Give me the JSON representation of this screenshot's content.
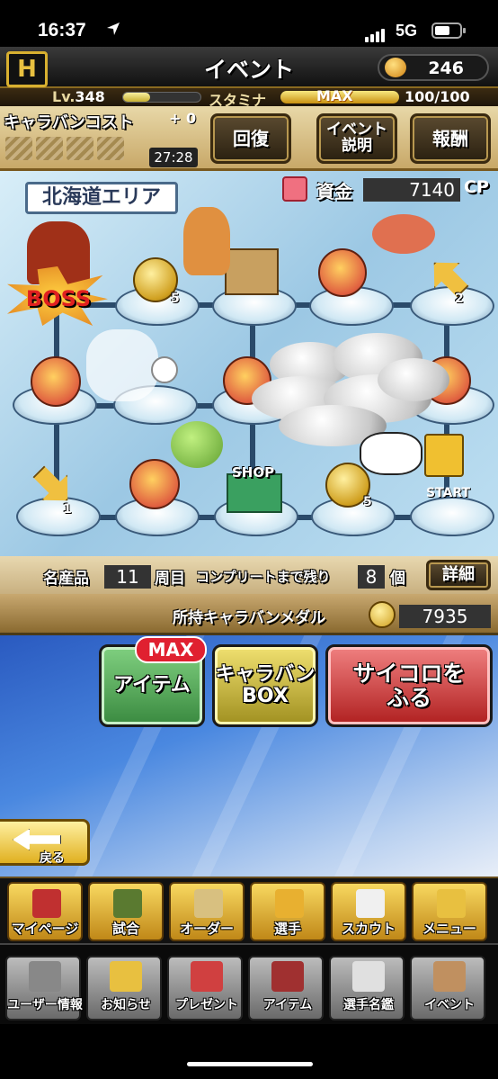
{
  "status_bar": {
    "time": "16:37",
    "network": "5G"
  },
  "header": {
    "title": "イベント",
    "logo": "H",
    "coins": "246"
  },
  "level": {
    "label": "Lv.",
    "value": "348",
    "exp_fraction": 0.35,
    "stamina_label": "スタミナ",
    "stamina_badge": "MAX",
    "stamina_value": "100/100"
  },
  "caravan": {
    "cost_title": "キャラバンコスト",
    "cost_plus": "+ 0",
    "timer": "27:28"
  },
  "commands": {
    "recover": "回復",
    "event_desc_1": "イベント",
    "event_desc_2": "説明",
    "reward": "報酬"
  },
  "map": {
    "area": "北海道エリア",
    "fund_label": "資金",
    "fund_value": "7140",
    "fund_unit": "CP",
    "boss_label": "BOSS",
    "shop_label": "SHOP",
    "start_label": "START",
    "tile_numbers": [
      "5",
      "2",
      "1",
      "5"
    ]
  },
  "progress": {
    "label_products": "名産品",
    "laps": "11",
    "laps_unit": "周目",
    "remain_label": "コンプリートまで残り",
    "remain": "8",
    "remain_unit": "個",
    "detail": "詳細"
  },
  "medals": {
    "label": "所持キャラバンメダル",
    "value": "7935"
  },
  "actions": {
    "max_badge": "MAX",
    "item": "アイテム",
    "box_1": "キャラバン",
    "box_2": "BOX",
    "dice_1": "サイコロを",
    "dice_2": "ふる"
  },
  "back": "戻る",
  "nav_main": [
    {
      "label": "マイページ",
      "color": "#c03030"
    },
    {
      "label": "試合",
      "color": "#5a7a30"
    },
    {
      "label": "オーダー",
      "color": "#d8c080"
    },
    {
      "label": "選手",
      "color": "#e8b030"
    },
    {
      "label": "スカウト",
      "color": "#f0f0f0"
    },
    {
      "label": "メニュー",
      "color": "#e8c040"
    }
  ],
  "nav_sub": [
    {
      "label": "ユーザー情報",
      "color": "#888"
    },
    {
      "label": "お知らせ",
      "color": "#e8c040"
    },
    {
      "label": "プレゼント",
      "color": "#d04040"
    },
    {
      "label": "アイテム",
      "color": "#a03030"
    },
    {
      "label": "選手名鑑",
      "color": "#e0e0e0"
    },
    {
      "label": "イベント",
      "color": "#c09060"
    }
  ]
}
